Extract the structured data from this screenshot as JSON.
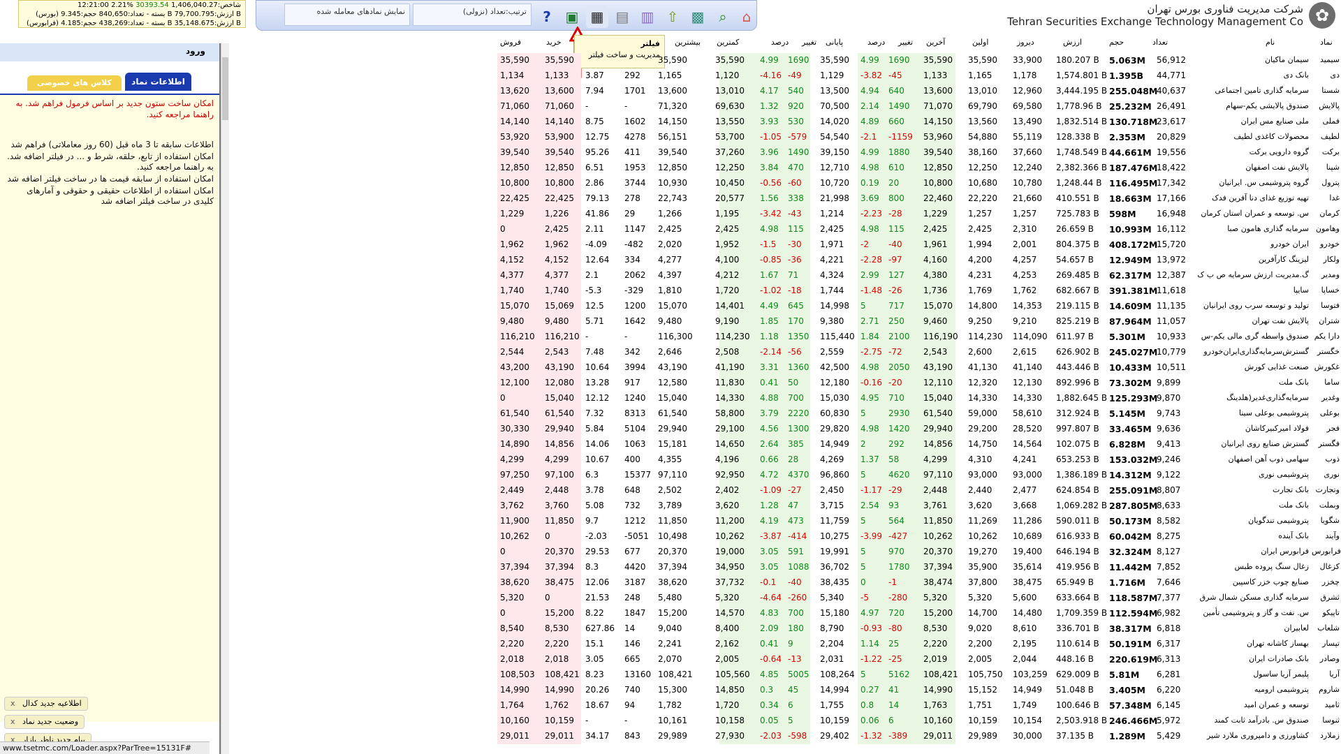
{
  "header": {
    "company_fa": "شرکت مدیریت فناوری بورس تهران",
    "company_en": "Tehran Securities Exchange Technology Management Co",
    "market": {
      "line1_time": "12:21:00",
      "line1_index": "شاخص:1,406,040.27",
      "line1_change": "30393.54",
      "line1_pct": "%2.21",
      "line2": "(بورس) بسته - تعداد:840,650 حجم:9.345 B ارزش:79,700.795 B",
      "line3": "(فرابورس) بسته - تعداد:438,269 حجم:4.185 B ارزش:35,148.675 B"
    }
  },
  "toolbar": {
    "sort_label": "ترتیب:تعداد (نزولی)",
    "filter_label": "نمایش نمادهای معامله شده",
    "buttons": [
      "home-icon",
      "search-icon",
      "grid-icon",
      "up-icon",
      "calendar-icon",
      "document-icon",
      "filter-grid-icon",
      "excel-icon",
      "help-icon"
    ]
  },
  "tooltip": {
    "title": "فیلتر",
    "subtitle": "مدیریت و ساخت فیلتر"
  },
  "left_panel": {
    "login": "ورود",
    "tab_symbol_info": "اطلاعات نماد",
    "tab_private": "کلاس های خصوصی",
    "notice_red": "امکان ساخت ستون جدید بر اساس فرمول فراهم شد. به راهنما مراجعه کنید.",
    "info_lines": [
      "اطلاعات سابقه تا 3 ماه قبل (60 روز معاملاتی) فراهم شد",
      "امکان استفاده از تابع، حلقه، شرط و ... در فیلتر اضافه شد. به راهنما مراجعه کنید.",
      "امکان استفاده از سابقه قیمت ها در ساخت فیلتر اضافه شد",
      "امکان استفاده از اطلاعات حقیقی و حقوقی و آمارهای کلیدی در ساخت فیلتر اضافه شد"
    ],
    "notices": [
      "اطلاعیه جدید کدال",
      "وضعیت جدید نماد",
      "پیام جدید ناظر بازار"
    ]
  },
  "status_bar": "www.tsetmc.com/Loader.aspx?ParTree=15131F#",
  "grid": {
    "headers": {
      "sell": "فروش",
      "buy": "خرید",
      "pe": "P/E",
      "eps": "EPS",
      "high": "بیشترین",
      "low": "کمترین",
      "close_pct": "درصد",
      "close_chg": "تغییر",
      "close": "پایانی",
      "last_pct": "درصد",
      "last_chg": "تغییر",
      "last": "آخرین",
      "first": "اولین",
      "yesterday": "دیروز",
      "value": "ارزش",
      "volume": "حجم",
      "count": "تعداد",
      "name": "نام",
      "symbol": "نماد"
    },
    "rows": [
      [
        "سیمید",
        "سیمان ماکیان",
        "56,912",
        "5.063M",
        "180.207 B",
        "33,900",
        "35,590",
        "35,590",
        "1690",
        "4.99",
        "35,590",
        "1690",
        "4.99",
        "35,590",
        "35,590",
        "",
        "",
        "35,590",
        "35,590"
      ],
      [
        "دی",
        "بانک دی",
        "44,771",
        "1.395B",
        "1,574.801 B",
        "1,178",
        "1,165",
        "1,133",
        "-45",
        "-3.82",
        "1,129",
        "-49",
        "-4.16",
        "1,120",
        "1,165",
        "292",
        "3.87",
        "1,133",
        "1,134"
      ],
      [
        "شستا",
        "سرمایه گذاری تامین اجتماعی",
        "40,637",
        "255.048M",
        "3,444.195 B",
        "12,960",
        "13,010",
        "13,600",
        "640",
        "4.94",
        "13,500",
        "540",
        "4.17",
        "13,010",
        "13,600",
        "1701",
        "7.94",
        "13,600",
        "13,620"
      ],
      [
        "پالایش",
        "صندوق پالایشی یکم-سهام",
        "26,491",
        "25.232M",
        "1,778.96 B",
        "69,580",
        "69,790",
        "71,070",
        "1490",
        "2.14",
        "70,500",
        "920",
        "1.32",
        "69,630",
        "71,320",
        "-",
        "-",
        "71,060",
        "71,060"
      ],
      [
        "فملی",
        "ملی صنایع مس ایران",
        "23,617",
        "130.718M",
        "1,832.514 B",
        "13,490",
        "13,560",
        "14,150",
        "660",
        "4.89",
        "14,020",
        "530",
        "3.93",
        "13,550",
        "14,150",
        "1602",
        "8.75",
        "14,140",
        "14,140"
      ],
      [
        "لطیف",
        "محصولات کاغذی لطیف",
        "20,829",
        "2.353M",
        "128.338 B",
        "55,119",
        "54,880",
        "53,960",
        "-1159",
        "-2.1",
        "54,540",
        "-579",
        "-1.05",
        "53,700",
        "56,151",
        "4278",
        "12.75",
        "53,900",
        "53,920"
      ],
      [
        "برکت",
        "گروه دارویی برکت",
        "19,556",
        "44.661M",
        "1,748.549 B",
        "37,660",
        "38,160",
        "39,540",
        "1880",
        "4.99",
        "39,150",
        "1490",
        "3.96",
        "37,260",
        "39,540",
        "411",
        "95.26",
        "39,540",
        "39,540"
      ],
      [
        "شپنا",
        "پالایش نفت اصفهان",
        "18,422",
        "187.476M",
        "2,382.366 B",
        "12,240",
        "12,250",
        "12,850",
        "610",
        "4.98",
        "12,710",
        "470",
        "3.84",
        "12,250",
        "12,850",
        "1953",
        "6.51",
        "12,850",
        "12,850"
      ],
      [
        "پترول",
        "گروه پتروشیمی س. ایرانیان",
        "17,342",
        "116.495M",
        "1,248.44 B",
        "10,780",
        "10,680",
        "10,800",
        "20",
        "0.19",
        "10,720",
        "-60",
        "-0.56",
        "10,450",
        "10,930",
        "3744",
        "2.86",
        "10,800",
        "10,800"
      ],
      [
        "غدا",
        "تهیه توزیع غذای دنا آفرین فدک",
        "17,166",
        "18.663M",
        "410.551 B",
        "21,660",
        "22,220",
        "22,460",
        "800",
        "3.69",
        "21,998",
        "338",
        "1.56",
        "20,577",
        "22,743",
        "278",
        "79.13",
        "22,425",
        "22,425"
      ],
      [
        "کرمان",
        "س. توسعه و عمران استان کرمان",
        "16,948",
        "598M",
        "725.783 B",
        "1,257",
        "1,257",
        "1,229",
        "-28",
        "-2.23",
        "1,214",
        "-43",
        "-3.42",
        "1,195",
        "1,266",
        "29",
        "41.86",
        "1,226",
        "1,229"
      ],
      [
        "وهامون",
        "سرمایه گذاری هامون صبا",
        "16,112",
        "10.993M",
        "26.659 B",
        "2,310",
        "2,425",
        "2,425",
        "115",
        "4.98",
        "2,425",
        "115",
        "4.98",
        "2,425",
        "2,425",
        "1147",
        "2.11",
        "2,425",
        "0"
      ],
      [
        "خودرو",
        "ایران خودرو",
        "15,720",
        "408.172M",
        "804.375 B",
        "2,001",
        "1,994",
        "1,961",
        "-40",
        "-2",
        "1,971",
        "-30",
        "-1.5",
        "1,952",
        "2,020",
        "-482",
        "-4.09",
        "1,962",
        "1,962"
      ],
      [
        "ولکار",
        "لیزینگ کارآفرین",
        "13,972",
        "12.949M",
        "54.657 B",
        "4,257",
        "4,200",
        "4,160",
        "-97",
        "-2.28",
        "4,221",
        "-36",
        "-0.85",
        "4,100",
        "4,277",
        "334",
        "12.64",
        "4,152",
        "4,152"
      ],
      [
        "ومدیر",
        "گ.مدیریت ارزش سرمایه ص ب ک",
        "12,387",
        "62.317M",
        "269.485 B",
        "4,253",
        "4,231",
        "4,380",
        "127",
        "2.99",
        "4,324",
        "71",
        "1.67",
        "4,212",
        "4,397",
        "2062",
        "2.1",
        "4,377",
        "4,377"
      ],
      [
        "خساپا",
        "سایپا",
        "11,618",
        "391.381M",
        "682.667 B",
        "1,762",
        "1,769",
        "1,736",
        "-26",
        "-1.48",
        "1,744",
        "-18",
        "-1.02",
        "1,720",
        "1,810",
        "-329",
        "-5.3",
        "1,740",
        "1,740"
      ],
      [
        "فتوسا",
        "تولید و توسعه سرب روی ایرانیان",
        "11,135",
        "14.609M",
        "219.115 B",
        "14,353",
        "14,800",
        "15,070",
        "717",
        "5",
        "14,998",
        "645",
        "4.49",
        "14,401",
        "15,070",
        "1200",
        "12.5",
        "15,069",
        "15,070"
      ],
      [
        "شتران",
        "پالایش نفت تهران",
        "11,057",
        "87.964M",
        "825.219 B",
        "9,210",
        "9,250",
        "9,460",
        "250",
        "2.71",
        "9,380",
        "170",
        "1.85",
        "9,190",
        "9,480",
        "1642",
        "5.71",
        "9,480",
        "9,480"
      ],
      [
        "دارا یکم",
        "صندوق واسطه گری مالی یکم-س",
        "10,933",
        "5.301M",
        "611.97 B",
        "114,090",
        "114,230",
        "116,190",
        "2100",
        "1.84",
        "115,440",
        "1350",
        "1.18",
        "114,230",
        "116,300",
        "-",
        "-",
        "116,210",
        "116,210"
      ],
      [
        "خگستر",
        "گسترش‌سرمایه‌گذاری‌ایران‌خودرو",
        "10,779",
        "245.027M",
        "626.902 B",
        "2,615",
        "2,600",
        "2,543",
        "-72",
        "-2.75",
        "2,559",
        "-56",
        "-2.14",
        "2,508",
        "2,646",
        "342",
        "7.48",
        "2,543",
        "2,544"
      ],
      [
        "غکورش",
        "صنعت غذایی کورش",
        "10,511",
        "10.433M",
        "443.446 B",
        "41,140",
        "41,130",
        "43,190",
        "2050",
        "4.98",
        "42,500",
        "1360",
        "3.31",
        "41,190",
        "43,190",
        "3994",
        "10.64",
        "43,190",
        "43,200"
      ],
      [
        "ساما",
        "بانک ملت",
        "9,899",
        "73.302M",
        "892.996 B",
        "12,130",
        "12,320",
        "12,110",
        "-20",
        "-0.16",
        "12,180",
        "50",
        "0.41",
        "11,830",
        "12,580",
        "917",
        "13.28",
        "12,080",
        "12,100"
      ],
      [
        "وغدیر",
        "سرمایه‌گذاری‌غدیر(هلدینگ",
        "9,870",
        "125.293M",
        "1,882.645 B",
        "14,330",
        "14,330",
        "15,040",
        "710",
        "4.95",
        "15,030",
        "700",
        "4.88",
        "14,330",
        "15,040",
        "1240",
        "12.12",
        "15,040",
        "0"
      ],
      [
        "بوعلی",
        "پتروشیمی بوعلی سینا",
        "9,743",
        "5.145M",
        "312.924 B",
        "58,610",
        "59,000",
        "61,540",
        "2930",
        "5",
        "60,830",
        "2220",
        "3.79",
        "58,800",
        "61,540",
        "8313",
        "7.32",
        "61,540",
        "61,540"
      ],
      [
        "فجر",
        "فولاد امیرکبیرکاشان",
        "9,636",
        "33.465M",
        "997.807 B",
        "28,520",
        "29,200",
        "29,940",
        "1420",
        "4.98",
        "29,820",
        "1300",
        "4.56",
        "29,100",
        "29,940",
        "5104",
        "5.84",
        "29,940",
        "30,330"
      ],
      [
        "فگستر",
        "گسترش صنایع روی ایرانیان",
        "9,413",
        "6.828M",
        "102.075 B",
        "14,564",
        "14,750",
        "14,856",
        "292",
        "2",
        "14,949",
        "385",
        "2.64",
        "14,650",
        "15,181",
        "1063",
        "14.06",
        "14,856",
        "14,890"
      ],
      [
        "ذوب",
        "سهامی ذوب آهن اصفهان",
        "9,246",
        "153.032M",
        "653.253 B",
        "4,241",
        "4,310",
        "4,299",
        "58",
        "1.37",
        "4,269",
        "28",
        "0.66",
        "4,196",
        "4,355",
        "400",
        "10.67",
        "4,299",
        "4,299"
      ],
      [
        "نوری",
        "پتروشیمی نوری",
        "9,122",
        "14.312M",
        "1,386.189 B",
        "93,000",
        "93,000",
        "97,110",
        "4620",
        "5",
        "96,860",
        "4370",
        "4.72",
        "92,950",
        "97,110",
        "15377",
        "6.3",
        "97,100",
        "97,250"
      ],
      [
        "وتجارت",
        "بانک تجارت",
        "8,807",
        "255.091M",
        "624.854 B",
        "2,477",
        "2,440",
        "2,448",
        "-29",
        "-1.17",
        "2,450",
        "-27",
        "-1.09",
        "2,402",
        "2,502",
        "648",
        "3.78",
        "2,448",
        "2,449"
      ],
      [
        "وبملت",
        "بانک ملت",
        "8,633",
        "287.805M",
        "1,069.282 B",
        "3,668",
        "3,620",
        "3,761",
        "93",
        "2.54",
        "3,715",
        "47",
        "1.28",
        "3,620",
        "3,789",
        "732",
        "5.08",
        "3,760",
        "3,762"
      ],
      [
        "شگویا",
        "پتروشیمی تندگویان",
        "8,582",
        "50.173M",
        "590.011 B",
        "11,286",
        "11,269",
        "11,850",
        "564",
        "5",
        "11,759",
        "473",
        "4.19",
        "11,200",
        "11,850",
        "1212",
        "9.7",
        "11,850",
        "11,900"
      ],
      [
        "وآیند",
        "بانک آینده",
        "8,275",
        "60.042M",
        "616.933 B",
        "10,689",
        "10,262",
        "10,262",
        "-427",
        "-3.99",
        "10,275",
        "-414",
        "-3.87",
        "10,262",
        "10,498",
        "-5051",
        "-2.03",
        "0",
        "10,262"
      ],
      [
        "فرابورس",
        "فرابورس ایران",
        "8,127",
        "32.324M",
        "646.194 B",
        "19,400",
        "19,270",
        "20,370",
        "970",
        "5",
        "19,991",
        "591",
        "3.05",
        "19,000",
        "20,370",
        "677",
        "29.53",
        "20,370",
        "0"
      ],
      [
        "کزغال",
        "زغال سنگ پروده طبس",
        "7,852",
        "11.442M",
        "419.956 B",
        "35,614",
        "35,900",
        "37,394",
        "1780",
        "5",
        "36,702",
        "1088",
        "3.05",
        "34,950",
        "37,394",
        "4420",
        "8.3",
        "37,394",
        "37,394"
      ],
      [
        "چخزر",
        "صنایع چوب خزر کاسپین",
        "7,646",
        "1.716M",
        "65.949 B",
        "38,475",
        "37,800",
        "38,474",
        "-1",
        "0",
        "38,435",
        "-40",
        "-0.1",
        "37,732",
        "38,620",
        "3187",
        "12.06",
        "38,475",
        "38,620"
      ],
      [
        "ثشرق",
        "سرمایه گذاری مسکن شمال شرق",
        "7,377",
        "118.587M",
        "633.664 B",
        "5,600",
        "5,320",
        "5,320",
        "-280",
        "-5",
        "5,340",
        "-260",
        "-4.64",
        "5,320",
        "5,480",
        "248",
        "21.53",
        "0",
        "5,320"
      ],
      [
        "تاپیکو",
        "س. نفت و گاز و پتروشیمی تأمین",
        "6,982",
        "112.594M",
        "1,709.359 B",
        "14,480",
        "14,700",
        "15,200",
        "720",
        "4.97",
        "15,180",
        "700",
        "4.83",
        "14,570",
        "15,200",
        "1847",
        "8.22",
        "15,200",
        "0"
      ],
      [
        "شلعاب",
        "لعابیران",
        "6,818",
        "38.317M",
        "336.701 B",
        "8,610",
        "9,020",
        "8,530",
        "-80",
        "-0.93",
        "8,790",
        "180",
        "2.09",
        "8,400",
        "9,040",
        "14",
        "627.86",
        "8,530",
        "8,540"
      ],
      [
        "تپسار",
        "بهساز کاشانه تهران",
        "6,317",
        "50.191M",
        "110.614 B",
        "2,195",
        "2,200",
        "2,220",
        "25",
        "1.14",
        "2,204",
        "9",
        "0.41",
        "2,162",
        "2,241",
        "146",
        "15.1",
        "2,220",
        "2,220"
      ],
      [
        "وصادر",
        "بانک صادرات ایران",
        "6,313",
        "220.619M",
        "448.16 B",
        "2,044",
        "2,005",
        "2,019",
        "-25",
        "-1.22",
        "2,031",
        "-13",
        "-0.64",
        "2,005",
        "2,070",
        "665",
        "3.05",
        "2,018",
        "2,018"
      ],
      [
        "آریا",
        "پلیمر آریا ساسول",
        "6,281",
        "5.81M",
        "629.009 B",
        "103,259",
        "105,750",
        "108,421",
        "5162",
        "5",
        "108,264",
        "5005",
        "4.85",
        "105,560",
        "108,421",
        "13160",
        "8.23",
        "108,421",
        "108,503"
      ],
      [
        "شاروم",
        "پتروشیمی ارومیه",
        "6,220",
        "3.405M",
        "51.048 B",
        "14,949",
        "15,152",
        "14,990",
        "41",
        "0.27",
        "14,994",
        "45",
        "0.3",
        "14,850",
        "15,300",
        "740",
        "20.26",
        "14,990",
        "14,990"
      ],
      [
        "ثامید",
        "توسعه و عمران امید",
        "6,145",
        "57.348M",
        "100.646 B",
        "1,749",
        "1,751",
        "1,763",
        "14",
        "0.8",
        "1,755",
        "6",
        "0.34",
        "1,720",
        "1,782",
        "94",
        "18.67",
        "1,762",
        "1,764"
      ],
      [
        "ثنوسا",
        "صندوق س. بادرآمد ثابت کمند",
        "5,972",
        "246.466M",
        "2,503.918 B",
        "10,154",
        "10,159",
        "10,160",
        "6",
        "0.06",
        "10,159",
        "5",
        "0.05",
        "10,158",
        "10,161",
        "-",
        "-",
        "10,159",
        "10,160"
      ],
      [
        "زملارد",
        "کشاورزی و دامپروری ملارد شیر",
        "5,429",
        "1.289M",
        "37.135 B",
        "30,000",
        "29,989",
        "29,011",
        "-389",
        "-1.32",
        "29,402",
        "-598",
        "-2.03",
        "27,930",
        "29,989",
        "843",
        "34.17",
        "29,011",
        "29,011"
      ]
    ]
  },
  "colors": {
    "negative": "#e00000",
    "positive": "#0d8a1a",
    "accent": "#1a3bb0"
  }
}
